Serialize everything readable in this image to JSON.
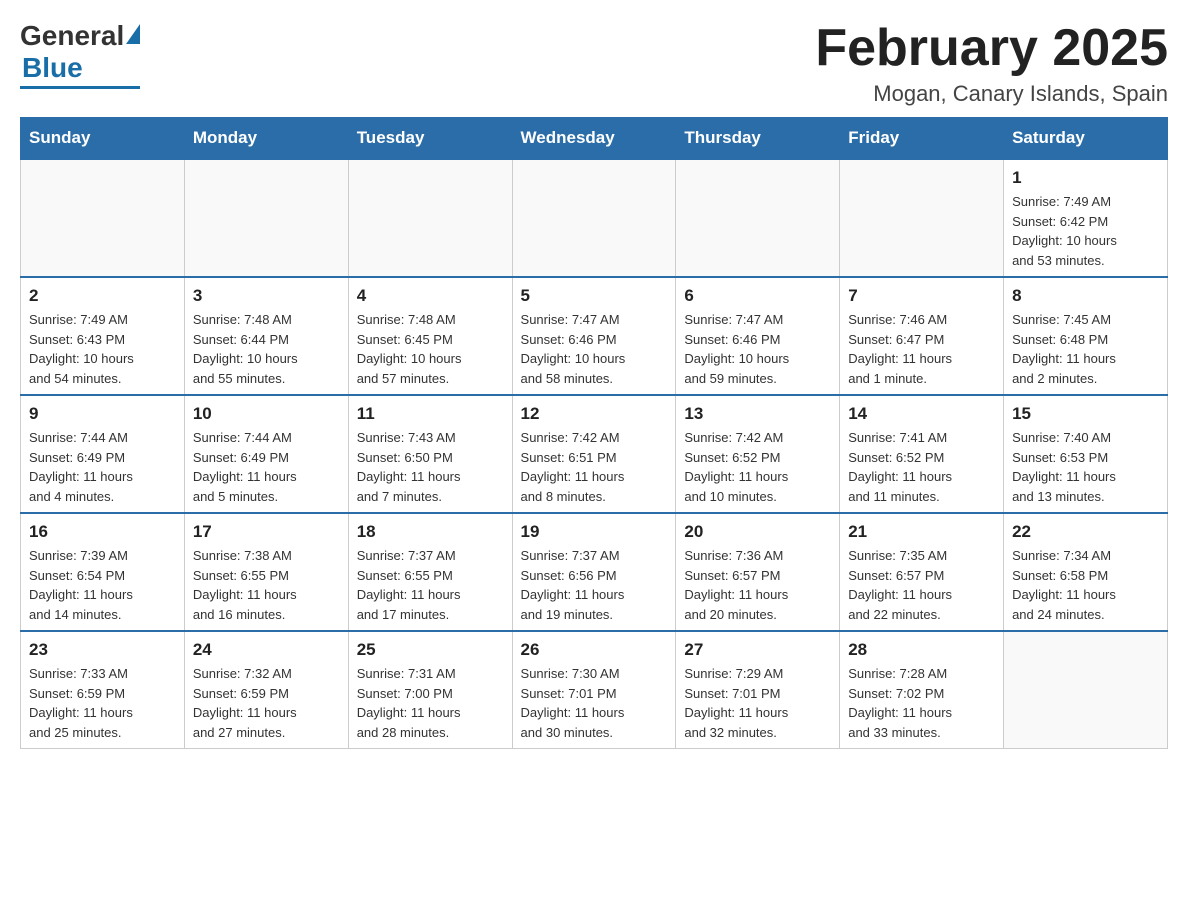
{
  "header": {
    "logo": {
      "general": "General",
      "blue": "Blue"
    },
    "title": "February 2025",
    "location": "Mogan, Canary Islands, Spain"
  },
  "days_of_week": [
    "Sunday",
    "Monday",
    "Tuesday",
    "Wednesday",
    "Thursday",
    "Friday",
    "Saturday"
  ],
  "weeks": [
    [
      {
        "day": "",
        "info": ""
      },
      {
        "day": "",
        "info": ""
      },
      {
        "day": "",
        "info": ""
      },
      {
        "day": "",
        "info": ""
      },
      {
        "day": "",
        "info": ""
      },
      {
        "day": "",
        "info": ""
      },
      {
        "day": "1",
        "info": "Sunrise: 7:49 AM\nSunset: 6:42 PM\nDaylight: 10 hours\nand 53 minutes."
      }
    ],
    [
      {
        "day": "2",
        "info": "Sunrise: 7:49 AM\nSunset: 6:43 PM\nDaylight: 10 hours\nand 54 minutes."
      },
      {
        "day": "3",
        "info": "Sunrise: 7:48 AM\nSunset: 6:44 PM\nDaylight: 10 hours\nand 55 minutes."
      },
      {
        "day": "4",
        "info": "Sunrise: 7:48 AM\nSunset: 6:45 PM\nDaylight: 10 hours\nand 57 minutes."
      },
      {
        "day": "5",
        "info": "Sunrise: 7:47 AM\nSunset: 6:46 PM\nDaylight: 10 hours\nand 58 minutes."
      },
      {
        "day": "6",
        "info": "Sunrise: 7:47 AM\nSunset: 6:46 PM\nDaylight: 10 hours\nand 59 minutes."
      },
      {
        "day": "7",
        "info": "Sunrise: 7:46 AM\nSunset: 6:47 PM\nDaylight: 11 hours\nand 1 minute."
      },
      {
        "day": "8",
        "info": "Sunrise: 7:45 AM\nSunset: 6:48 PM\nDaylight: 11 hours\nand 2 minutes."
      }
    ],
    [
      {
        "day": "9",
        "info": "Sunrise: 7:44 AM\nSunset: 6:49 PM\nDaylight: 11 hours\nand 4 minutes."
      },
      {
        "day": "10",
        "info": "Sunrise: 7:44 AM\nSunset: 6:49 PM\nDaylight: 11 hours\nand 5 minutes."
      },
      {
        "day": "11",
        "info": "Sunrise: 7:43 AM\nSunset: 6:50 PM\nDaylight: 11 hours\nand 7 minutes."
      },
      {
        "day": "12",
        "info": "Sunrise: 7:42 AM\nSunset: 6:51 PM\nDaylight: 11 hours\nand 8 minutes."
      },
      {
        "day": "13",
        "info": "Sunrise: 7:42 AM\nSunset: 6:52 PM\nDaylight: 11 hours\nand 10 minutes."
      },
      {
        "day": "14",
        "info": "Sunrise: 7:41 AM\nSunset: 6:52 PM\nDaylight: 11 hours\nand 11 minutes."
      },
      {
        "day": "15",
        "info": "Sunrise: 7:40 AM\nSunset: 6:53 PM\nDaylight: 11 hours\nand 13 minutes."
      }
    ],
    [
      {
        "day": "16",
        "info": "Sunrise: 7:39 AM\nSunset: 6:54 PM\nDaylight: 11 hours\nand 14 minutes."
      },
      {
        "day": "17",
        "info": "Sunrise: 7:38 AM\nSunset: 6:55 PM\nDaylight: 11 hours\nand 16 minutes."
      },
      {
        "day": "18",
        "info": "Sunrise: 7:37 AM\nSunset: 6:55 PM\nDaylight: 11 hours\nand 17 minutes."
      },
      {
        "day": "19",
        "info": "Sunrise: 7:37 AM\nSunset: 6:56 PM\nDaylight: 11 hours\nand 19 minutes."
      },
      {
        "day": "20",
        "info": "Sunrise: 7:36 AM\nSunset: 6:57 PM\nDaylight: 11 hours\nand 20 minutes."
      },
      {
        "day": "21",
        "info": "Sunrise: 7:35 AM\nSunset: 6:57 PM\nDaylight: 11 hours\nand 22 minutes."
      },
      {
        "day": "22",
        "info": "Sunrise: 7:34 AM\nSunset: 6:58 PM\nDaylight: 11 hours\nand 24 minutes."
      }
    ],
    [
      {
        "day": "23",
        "info": "Sunrise: 7:33 AM\nSunset: 6:59 PM\nDaylight: 11 hours\nand 25 minutes."
      },
      {
        "day": "24",
        "info": "Sunrise: 7:32 AM\nSunset: 6:59 PM\nDaylight: 11 hours\nand 27 minutes."
      },
      {
        "day": "25",
        "info": "Sunrise: 7:31 AM\nSunset: 7:00 PM\nDaylight: 11 hours\nand 28 minutes."
      },
      {
        "day": "26",
        "info": "Sunrise: 7:30 AM\nSunset: 7:01 PM\nDaylight: 11 hours\nand 30 minutes."
      },
      {
        "day": "27",
        "info": "Sunrise: 7:29 AM\nSunset: 7:01 PM\nDaylight: 11 hours\nand 32 minutes."
      },
      {
        "day": "28",
        "info": "Sunrise: 7:28 AM\nSunset: 7:02 PM\nDaylight: 11 hours\nand 33 minutes."
      },
      {
        "day": "",
        "info": ""
      }
    ]
  ]
}
